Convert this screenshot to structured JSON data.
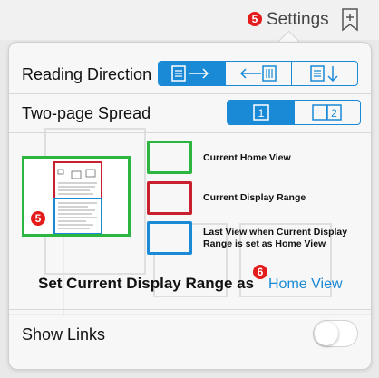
{
  "toolbar": {
    "marker": "5",
    "settings_label": "Settings",
    "bookmark_icon": "bookmark-add-icon"
  },
  "settings": {
    "reading_direction": {
      "label": "Reading Direction",
      "options": [
        "left-to-right-icon",
        "right-to-left-icon",
        "top-to-bottom-icon"
      ],
      "selected_index": 0
    },
    "two_page_spread": {
      "label": "Two-page Spread",
      "options": [
        "1",
        "2"
      ],
      "selected_index": 0
    },
    "legend": {
      "marker": "5",
      "items": [
        {
          "label": "Current Home View",
          "color": "#2db541"
        },
        {
          "label": "Current Display Range",
          "color": "#c8202f"
        },
        {
          "label": "Last View when Current Display Range is set as Home View",
          "color": "#1a8ad6"
        }
      ]
    },
    "display_range": {
      "label": "Set Current Display Range as",
      "marker": "6",
      "link": "Home View"
    },
    "show_links": {
      "label": "Show Links",
      "on": false
    }
  },
  "colors": {
    "accent": "#1a8ad6",
    "marker_red": "#e41b1b"
  }
}
